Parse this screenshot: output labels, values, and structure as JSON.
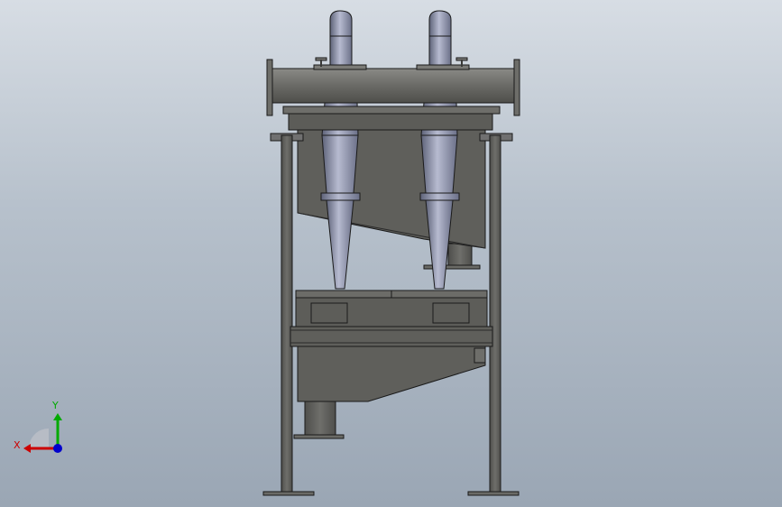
{
  "viewport": {
    "background_top": "#d7dde4",
    "background_bottom": "#9aa6b4"
  },
  "model": {
    "body_color": "#5f5f5b",
    "cyclone_color": "#8a8fa8",
    "edge_color": "#1a1a1a"
  },
  "triad": {
    "x_label": "X",
    "y_label": "Y",
    "x_color": "#cc0000",
    "y_color": "#00aa00",
    "z_color": "#0000cc"
  }
}
